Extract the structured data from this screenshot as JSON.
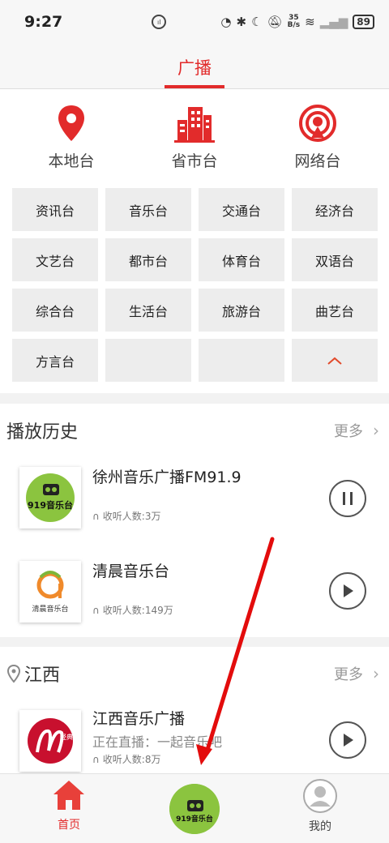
{
  "status_bar": {
    "time": "9:27",
    "net_speed_value": "35",
    "net_speed_unit": "B/s",
    "battery": "89"
  },
  "top_tab": {
    "label": "广播"
  },
  "big_categories": [
    {
      "label": "本地台",
      "icon": "location-pin-icon"
    },
    {
      "label": "省市台",
      "icon": "city-buildings-icon"
    },
    {
      "label": "网络台",
      "icon": "broadcast-signal-icon"
    }
  ],
  "chips": [
    "资讯台",
    "音乐台",
    "交通台",
    "经济台",
    "文艺台",
    "都市台",
    "体育台",
    "双语台",
    "综合台",
    "生活台",
    "旅游台",
    "曲艺台",
    "方言台"
  ],
  "chip_collapse_icon": "chevron-up-icon",
  "history": {
    "title": "播放历史",
    "more": "更多",
    "items": [
      {
        "name": "徐州音乐广播FM91.9",
        "listeners": "收听人数:3万",
        "state": "pause",
        "logo_text": "919音乐台"
      },
      {
        "name": "清晨音乐台",
        "listeners": "收听人数:149万",
        "state": "play",
        "logo_text": "清晨音乐台"
      }
    ]
  },
  "jiangxi": {
    "title": "江西",
    "more": "更多",
    "items": [
      {
        "name": "江西音乐广播",
        "now_playing": "正在直播：一起音乐吧",
        "listeners": "收听人数:8万",
        "state": "play",
        "logo_text": "经典"
      }
    ]
  },
  "bottom_nav": {
    "home": "首页",
    "mine": "我的",
    "center_logo": "919音乐台"
  },
  "colors": {
    "accent": "#e22b2b",
    "logo_green": "#8bc43f"
  }
}
